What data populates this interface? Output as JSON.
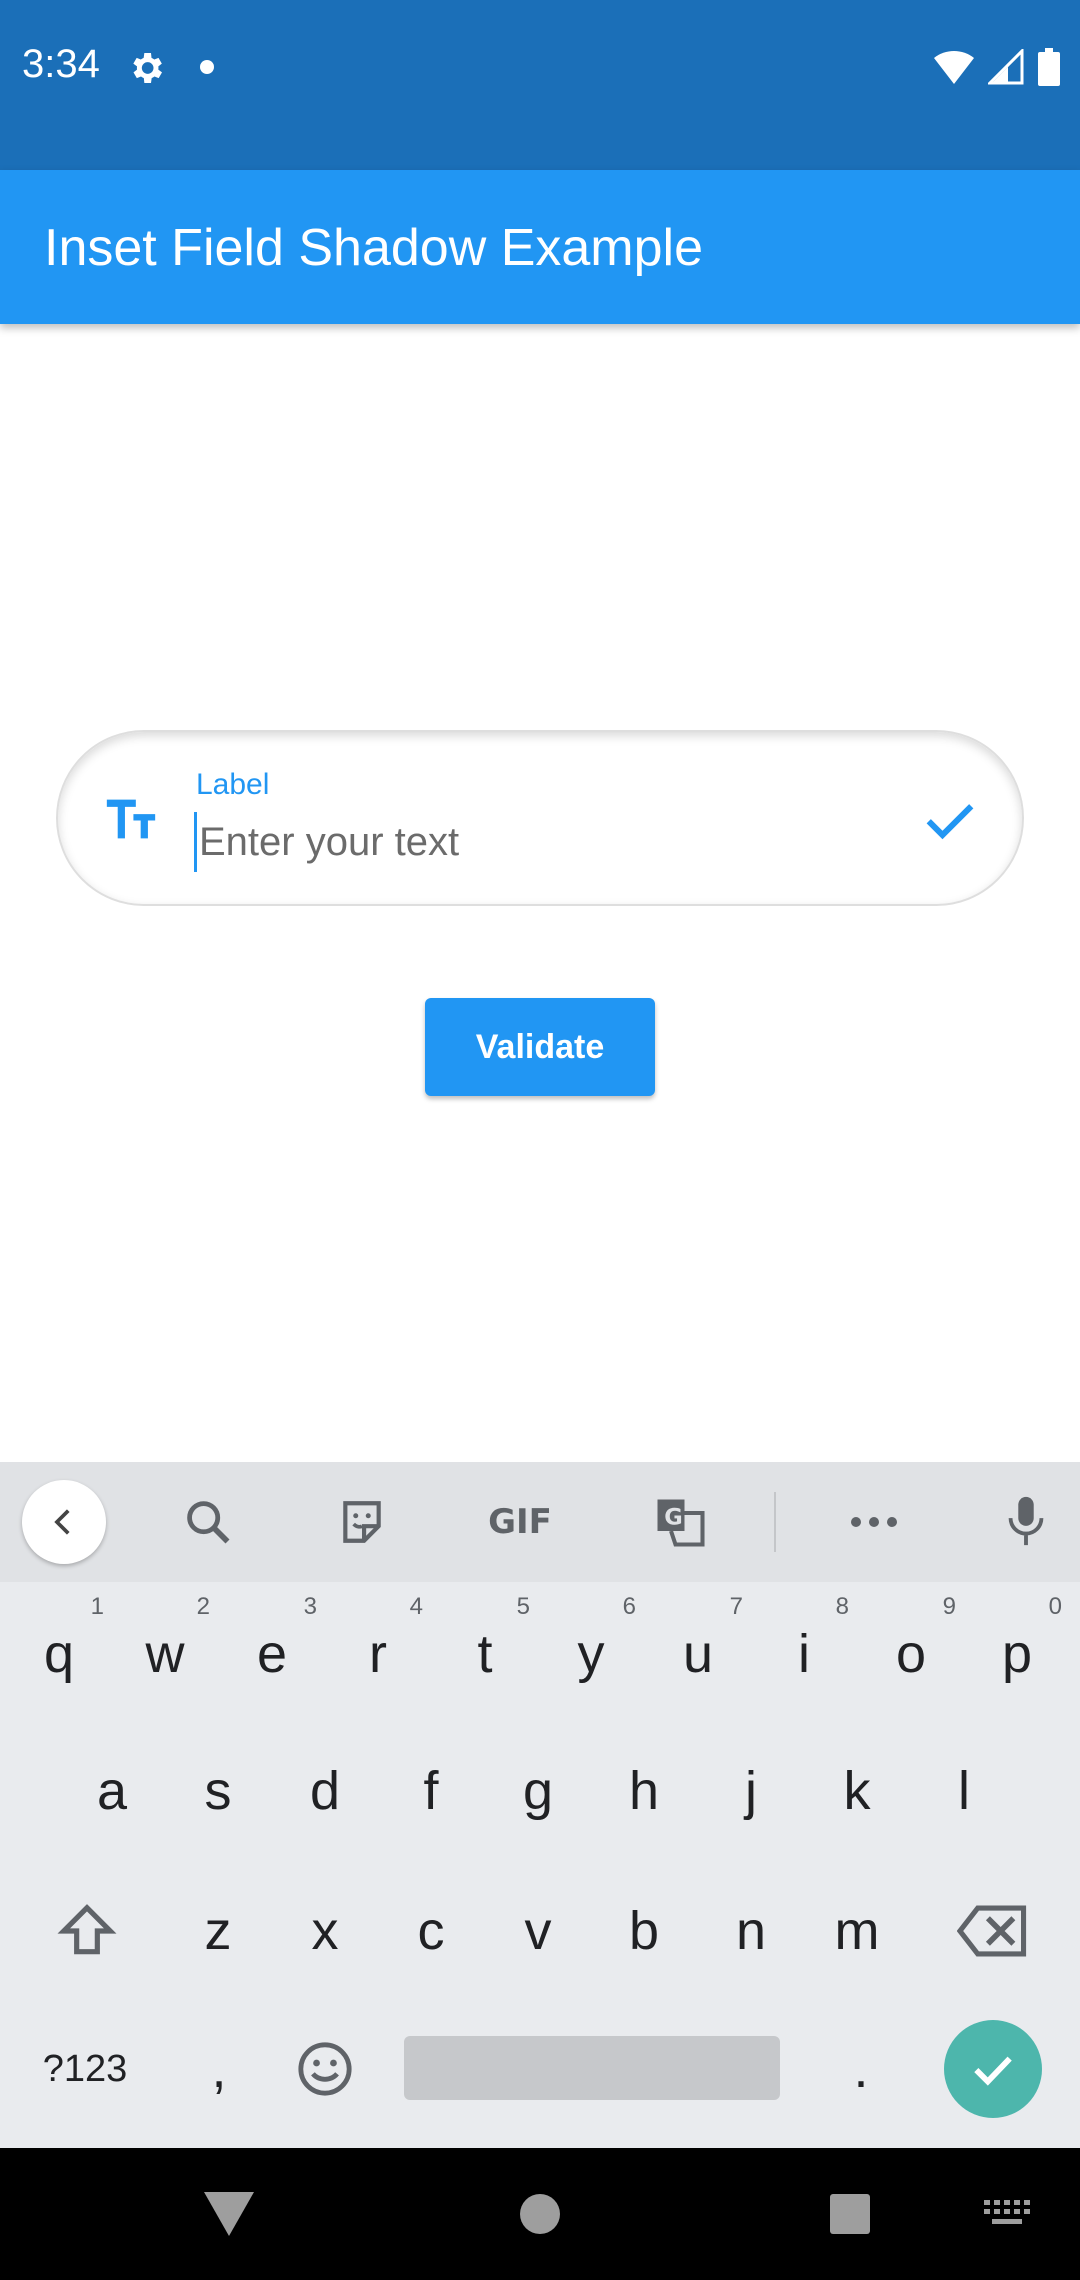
{
  "status_bar": {
    "time": "3:34"
  },
  "app_bar": {
    "title": "Inset Field Shadow Example"
  },
  "field": {
    "label": "Label",
    "placeholder": "Enter your text",
    "value": ""
  },
  "validate_button": {
    "label": "Validate"
  },
  "keyboard": {
    "toolbar": {
      "gif_label": "GIF"
    },
    "row1": [
      {
        "key": "q",
        "hint": "1"
      },
      {
        "key": "w",
        "hint": "2"
      },
      {
        "key": "e",
        "hint": "3"
      },
      {
        "key": "r",
        "hint": "4"
      },
      {
        "key": "t",
        "hint": "5"
      },
      {
        "key": "y",
        "hint": "6"
      },
      {
        "key": "u",
        "hint": "7"
      },
      {
        "key": "i",
        "hint": "8"
      },
      {
        "key": "o",
        "hint": "9"
      },
      {
        "key": "p",
        "hint": "0"
      }
    ],
    "row2": [
      "a",
      "s",
      "d",
      "f",
      "g",
      "h",
      "j",
      "k",
      "l"
    ],
    "row3": [
      "z",
      "x",
      "c",
      "v",
      "b",
      "n",
      "m"
    ],
    "row4": {
      "symbols": "?123",
      "comma": ",",
      "period": "."
    }
  },
  "colors": {
    "status_bar": "#1b6fb8",
    "primary": "#2196f3",
    "enter_key": "#4db6ac",
    "keyboard_bg": "#e9ebee"
  }
}
